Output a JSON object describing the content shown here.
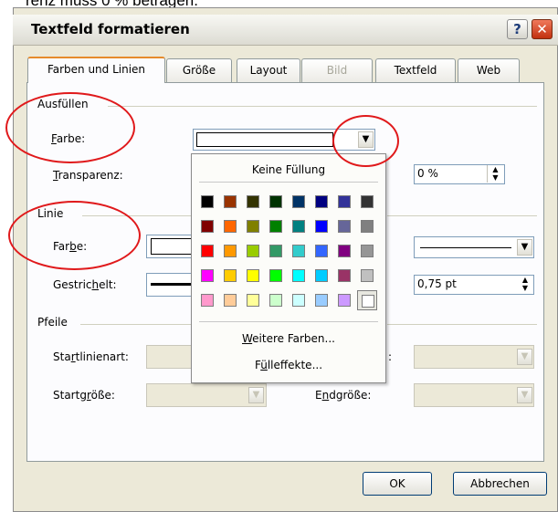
{
  "doc_fragment": "renz muss 0 % betragen.",
  "window": {
    "title": "Textfeld formatieren",
    "help": "?",
    "close": "✕"
  },
  "tabs": [
    {
      "label": "Farben und Linien"
    },
    {
      "label": "Größe"
    },
    {
      "label": "Layout"
    },
    {
      "label": "Bild"
    },
    {
      "label": "Textfeld"
    },
    {
      "label": "Web"
    }
  ],
  "fill": {
    "group": "Ausfüllen",
    "color_label_pre": "",
    "color_label_u": "F",
    "color_label_post": "arbe:",
    "transparency_label_u": "T",
    "transparency_label_post": "ransparenz:",
    "transparency_value": "0 %"
  },
  "line": {
    "group": "Linie",
    "color_label_pre": "Far",
    "color_label_u": "b",
    "color_label_post": "e:",
    "dash_label_pre": "Gestric",
    "dash_label_u": "h",
    "dash_label_post": "elt:",
    "weight_value": "0,75 pt"
  },
  "arrows": {
    "group": "Pfeile",
    "start_type_pre": "Sta",
    "start_type_u": "r",
    "start_type_post": "tlinienart:",
    "start_size_pre": "Startg",
    "start_size_u": "r",
    "start_size_post": "öße:",
    "end_size_pre": "E",
    "end_size_u": "n",
    "end_size_post": "dgröße:",
    "end_type_colon": ":"
  },
  "popup": {
    "no_fill": "Keine Füllung",
    "more_colors_u": "W",
    "more_colors_post": "eitere Farben...",
    "fill_effects_pre": "F",
    "fill_effects_u": "ü",
    "fill_effects_post": "lleffekte...",
    "colors": [
      [
        "#000000",
        "#993300",
        "#333300",
        "#003300",
        "#003366",
        "#000080",
        "#333399",
        "#333333"
      ],
      [
        "#800000",
        "#ff6600",
        "#808000",
        "#008000",
        "#008080",
        "#0000ff",
        "#666699",
        "#808080"
      ],
      [
        "#ff0000",
        "#ff9900",
        "#99cc00",
        "#339966",
        "#33cccc",
        "#3366ff",
        "#800080",
        "#969696"
      ],
      [
        "#ff00ff",
        "#ffcc00",
        "#ffff00",
        "#00ff00",
        "#00ffff",
        "#00ccff",
        "#993366",
        "#c0c0c0"
      ],
      [
        "#ff99cc",
        "#ffcc99",
        "#ffff99",
        "#ccffcc",
        "#ccffff",
        "#99ccff",
        "#cc99ff",
        "#ffffff"
      ]
    ]
  },
  "buttons": {
    "ok": "OK",
    "cancel": "Abbrechen"
  },
  "annotation_color": "#e0191b"
}
